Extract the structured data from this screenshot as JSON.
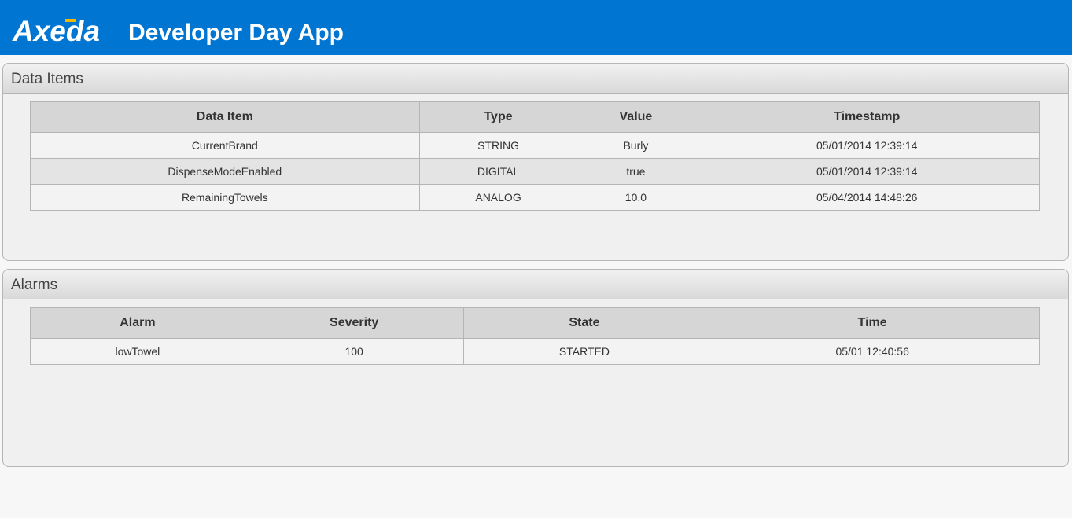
{
  "header": {
    "logo_text": "Axeda",
    "title": "Developer Day App"
  },
  "data_items": {
    "title": "Data Items",
    "columns": [
      "Data Item",
      "Type",
      "Value",
      "Timestamp"
    ],
    "rows": [
      [
        "CurrentBrand",
        "STRING",
        "Burly",
        "05/01/2014 12:39:14"
      ],
      [
        "DispenseModeEnabled",
        "DIGITAL",
        "true",
        "05/01/2014 12:39:14"
      ],
      [
        "RemainingTowels",
        "ANALOG",
        "10.0",
        "05/04/2014 14:48:26"
      ]
    ]
  },
  "alarms": {
    "title": "Alarms",
    "columns": [
      "Alarm",
      "Severity",
      "State",
      "Time"
    ],
    "rows": [
      [
        "lowTowel",
        "100",
        "STARTED",
        "05/01 12:40:56"
      ]
    ]
  },
  "colors": {
    "header_bg": "#0075d2",
    "logo_accent": "#f5b800"
  }
}
